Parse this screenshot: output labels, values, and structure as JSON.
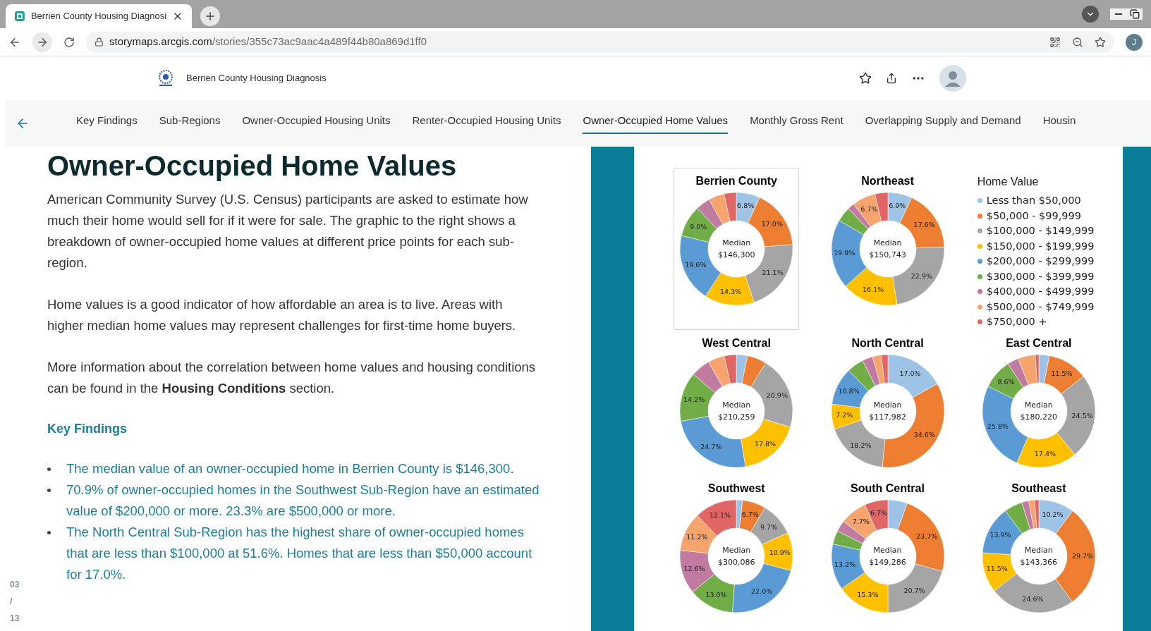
{
  "browser": {
    "tab_title": "Berrien County Housing Diagnosi",
    "url_domain": "storymaps.arcgis.com",
    "url_path": "/stories/355c73ac9aac4a489f44b80a869d1ff0",
    "profile_initial": "J"
  },
  "header": {
    "title": "Berrien County Housing Diagnosis"
  },
  "nav": {
    "tabs": [
      {
        "label": "Key Findings",
        "selected": false
      },
      {
        "label": "Sub-Regions",
        "selected": false
      },
      {
        "label": "Owner-Occupied Housing Units",
        "selected": false
      },
      {
        "label": "Renter-Occupied Housing Units",
        "selected": false
      },
      {
        "label": "Owner-Occupied Home Values",
        "selected": true
      },
      {
        "label": "Monthly Gross Rent",
        "selected": false
      },
      {
        "label": "Overlapping Supply and Demand",
        "selected": false
      },
      {
        "label": "Housin",
        "selected": false
      }
    ]
  },
  "article": {
    "heading": "Owner-Occupied Home Values",
    "paragraphs": [
      "American Community Survey (U.S. Census) participants are asked to estimate how much their home would sell for if it were for sale. The graphic to the right shows a breakdown of owner-occupied home values at different price points for each sub-region.",
      "Home values is a good indicator of how affordable an area is to live. Areas with higher median home values may represent challenges for first-time home buyers.",
      "More information about the correlation between home values and housing conditions can be found in the **Housing Conditions** section."
    ],
    "subheading": "Key Findings",
    "bullets": [
      "The median value of an owner-occupied home in Berrien County is $146,300.",
      "70.9% of owner-occupied homes in the Southwest Sub-Region have an estimated value of $200,000 or more. 23.3% are $500,000 or more.",
      "The North Central Sub-Region has the highest share of owner-occupied homes that are less than $100,000 at 51.6%. Homes that are less than $50,000 account for 17.0%."
    ]
  },
  "page_counter": {
    "current": "03",
    "separator": "/",
    "total": "13"
  },
  "infographic": {
    "legend": {
      "title": "Home Value",
      "items": [
        {
          "label": "Less than $50,000",
          "color": "#9dc3e6"
        },
        {
          "label": "$50,000 - $99,999",
          "color": "#ed7d31"
        },
        {
          "label": "$100,000 - $149,999",
          "color": "#a5a5a5"
        },
        {
          "label": "$150,000 - $199,999",
          "color": "#ffc000"
        },
        {
          "label": "$200,000 - $299,999",
          "color": "#5b9bd5"
        },
        {
          "label": "$300,000 - $399,999",
          "color": "#70ad47"
        },
        {
          "label": "$400,000 - $499,999",
          "color": "#c27ba0"
        },
        {
          "label": "$500,000 - $749,999",
          "color": "#f4a46c"
        },
        {
          "label": "$750,000 +",
          "color": "#e06666"
        }
      ]
    },
    "charts": [
      {
        "framed": true,
        "median_label": "Median",
        "median_value": "$146,300",
        "chart_data": {
          "type": "donut",
          "title": "Berrien County",
          "values": [
            6.8,
            17.0,
            21.1,
            14.3,
            19.6,
            9.0,
            4.2,
            4.5,
            3.5
          ],
          "value_labels": [
            "6.8%",
            "17.0%",
            "21.1%",
            "14.3%",
            "19.6%",
            "9.0%",
            null,
            null,
            null
          ]
        }
      },
      {
        "framed": false,
        "median_label": "Median",
        "median_value": "$150,743",
        "chart_data": {
          "type": "donut",
          "title": "Northeast",
          "values": [
            6.9,
            17.6,
            22.9,
            16.1,
            19.9,
            4.2,
            2.0,
            6.7,
            3.7
          ],
          "value_labels": [
            "6.9%",
            "17.6%",
            "22.9%",
            "16.1%",
            "19.9%",
            null,
            null,
            "6.7%",
            null
          ]
        }
      },
      {
        "framed": false,
        "median_label": "Median",
        "median_value": "$210,259",
        "chart_data": {
          "type": "donut",
          "title": "West Central",
          "values": [
            3.2,
            5.5,
            20.9,
            17.8,
            24.7,
            14.2,
            5.5,
            4.8,
            3.4
          ],
          "value_labels": [
            null,
            null,
            "20.9%",
            "17.8%",
            "24.7%",
            "14.2%",
            null,
            null,
            null
          ]
        }
      },
      {
        "framed": false,
        "median_label": "Median",
        "median_value": "$117,982",
        "chart_data": {
          "type": "donut",
          "title": "North Central",
          "values": [
            17.0,
            34.6,
            18.2,
            7.2,
            10.8,
            4.8,
            3.0,
            2.5,
            1.9
          ],
          "value_labels": [
            "17.0%",
            "34.6%",
            "18.2%",
            "7.2%",
            "10.8%",
            null,
            null,
            null,
            null
          ]
        }
      },
      {
        "framed": false,
        "median_label": "Median",
        "median_value": "$180,220",
        "chart_data": {
          "type": "donut",
          "title": "East Central",
          "values": [
            3.0,
            11.5,
            24.5,
            17.4,
            25.8,
            8.6,
            3.2,
            5.0,
            1.0
          ],
          "value_labels": [
            null,
            "11.5%",
            "24.5%",
            "17.4%",
            "25.8%",
            "8.6%",
            null,
            null,
            null
          ]
        }
      },
      {
        "framed": false,
        "median_label": "Median",
        "median_value": "$300,086",
        "chart_data": {
          "type": "donut",
          "title": "Southwest",
          "values": [
            1.8,
            6.7,
            9.7,
            10.9,
            22.0,
            13.0,
            12.6,
            11.2,
            12.1
          ],
          "value_labels": [
            null,
            "6.7%",
            "9.7%",
            "10.9%",
            "22.0%",
            "13.0%",
            "12.6%",
            "11.2%",
            "12.1%"
          ]
        }
      },
      {
        "framed": false,
        "median_label": "Median",
        "median_value": "$149,286",
        "chart_data": {
          "type": "donut",
          "title": "South Central",
          "values": [
            5.6,
            23.7,
            20.7,
            15.3,
            13.2,
            3.9,
            3.2,
            7.7,
            6.7
          ],
          "value_labels": [
            null,
            "23.7%",
            "20.7%",
            "15.3%",
            "13.2%",
            null,
            null,
            "7.7%",
            "6.7%"
          ]
        }
      },
      {
        "framed": false,
        "median_label": "Median",
        "median_value": "$143,366",
        "chart_data": {
          "type": "donut",
          "title": "Southeast",
          "values": [
            10.2,
            29.7,
            24.6,
            11.5,
            13.9,
            5.2,
            2.0,
            1.7,
            1.2
          ],
          "value_labels": [
            "10.2%",
            "29.7%",
            "24.6%",
            "11.5%",
            "13.9%",
            null,
            null,
            null,
            null
          ]
        }
      }
    ]
  }
}
